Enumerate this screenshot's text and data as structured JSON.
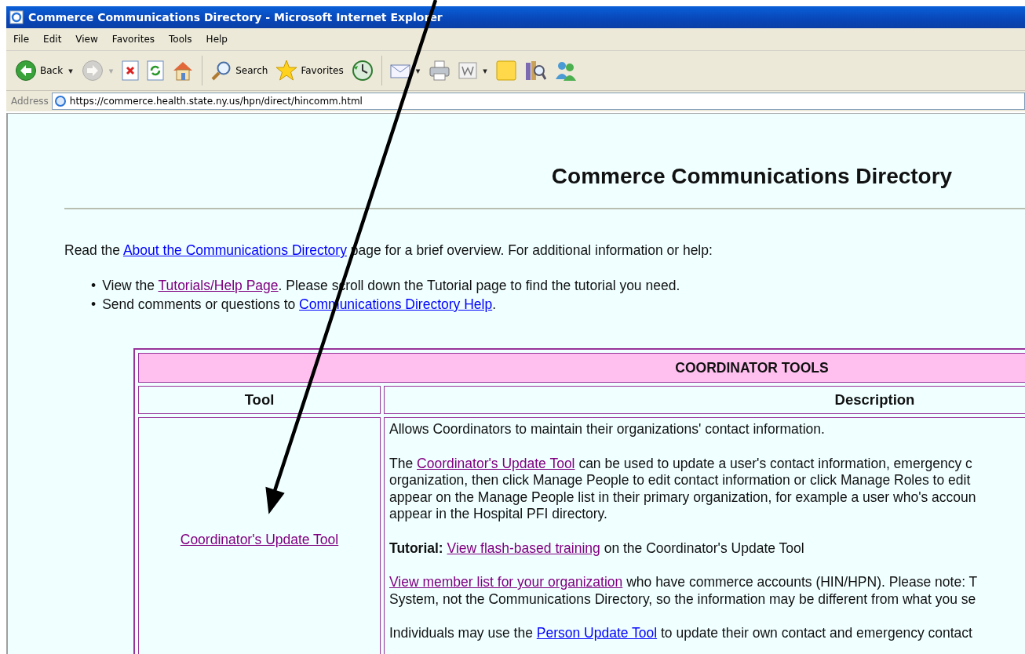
{
  "window": {
    "title": "Commerce Communications Directory - Microsoft Internet Explorer"
  },
  "menu": [
    {
      "label": "File"
    },
    {
      "label": "Edit"
    },
    {
      "label": "View"
    },
    {
      "label": "Favorites"
    },
    {
      "label": "Tools"
    },
    {
      "label": "Help"
    }
  ],
  "toolbar": [
    {
      "label": "Back",
      "caret": "▾",
      "disabled": false
    },
    {
      "caret": "▾",
      "disabled": true
    },
    {
      "disabled": false
    },
    {
      "disabled": false
    },
    {
      "disabled": false
    },
    {
      "label": "Search",
      "disabled": false
    },
    {
      "label": "Favorites",
      "disabled": false
    },
    {
      "disabled": false
    },
    {
      "caret": "▾",
      "disabled": false
    },
    {
      "disabled": false
    },
    {
      "caret": "▾",
      "disabled": false
    },
    {
      "disabled": false
    },
    {
      "disabled": false
    },
    {
      "disabled": false
    }
  ],
  "address": {
    "label": "Address",
    "value": "https://commerce.health.state.ny.us/hpn/direct/hincomm.html"
  },
  "page": {
    "heading": "Commerce Communications Directory",
    "intro": [
      {
        "kind": "text",
        "text": "Read the "
      },
      {
        "kind": "link",
        "text": "About the Communications Directory",
        "visited": false
      },
      {
        "kind": "text",
        "text": " page for a brief overview. For additional information or help:"
      }
    ],
    "bullets": [
      {
        "marker": "•",
        "segments": [
          {
            "kind": "text",
            "text": "View the "
          },
          {
            "kind": "link",
            "text": "Tutorials/Help Page",
            "visited": true
          },
          {
            "kind": "text",
            "text": ". Please scroll down the Tutorial page to find the tutorial you need."
          }
        ]
      },
      {
        "marker": "•",
        "segments": [
          {
            "kind": "text",
            "text": "Send comments or questions to "
          },
          {
            "kind": "link",
            "text": "Communications Directory Help",
            "visited": false
          },
          {
            "kind": "text",
            "text": "."
          }
        ]
      }
    ],
    "table": {
      "title": "COORDINATOR TOOLS",
      "columns": [
        "Tool",
        "Description"
      ],
      "rows": [
        {
          "tool": {
            "text": "Coordinator's Update Tool",
            "visited": true
          },
          "description": [
            [
              [
                {
                  "kind": "text",
                  "text": "Allows Coordinators to maintain their organizations' contact information."
                }
              ]
            ],
            [
              [
                {
                  "kind": "text",
                  "text": "The "
                },
                {
                  "kind": "link",
                  "text": "Coordinator's Update Tool",
                  "visited": true
                },
                {
                  "kind": "text",
                  "text": " can be used to update a user's contact information, emergency c"
                }
              ],
              [
                {
                  "kind": "text",
                  "text": "organization, then click Manage People to edit contact information or click Manage Roles to edit"
                }
              ],
              [
                {
                  "kind": "text",
                  "text": "appear on the Manage People list in their primary organization, for example a user who's accoun"
                }
              ],
              [
                {
                  "kind": "text",
                  "text": "appear in the Hospital PFI directory."
                }
              ]
            ],
            [
              [
                {
                  "kind": "bold",
                  "text": "Tutorial: "
                },
                {
                  "kind": "link",
                  "text": "View flash-based training",
                  "visited": true
                },
                {
                  "kind": "text",
                  "text": " on the Coordinator's Update Tool"
                }
              ]
            ],
            [
              [
                {
                  "kind": "link",
                  "text": "View member list for your organization",
                  "visited": true
                },
                {
                  "kind": "text",
                  "text": " who have commerce accounts (HIN/HPN). Please note: T"
                }
              ],
              [
                {
                  "kind": "text",
                  "text": "System, not the Communications Directory, so the information may be different from what you se"
                }
              ]
            ],
            [
              [
                {
                  "kind": "text",
                  "text": "Individuals may use the "
                },
                {
                  "kind": "link",
                  "text": "Person Update Tool",
                  "visited": false
                },
                {
                  "kind": "text",
                  "text": " to update their own contact and emergency contact"
                }
              ]
            ]
          ]
        }
      ]
    }
  }
}
